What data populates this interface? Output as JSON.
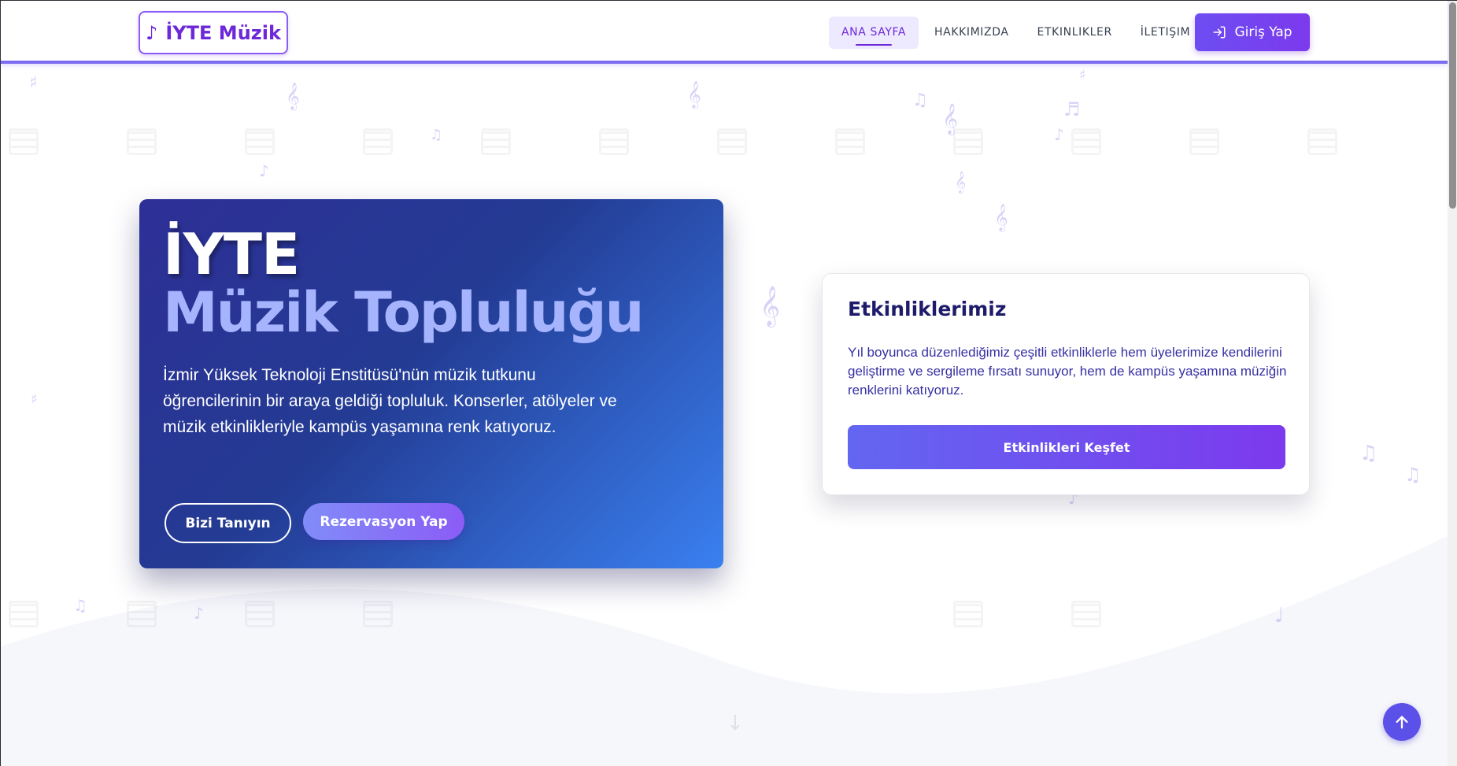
{
  "brand": {
    "note_icon": "music-note-icon",
    "note_glyph": "♪",
    "name": "İYTE Müzik"
  },
  "nav": {
    "items": [
      {
        "label": "ANA SAYFA",
        "active": true
      },
      {
        "label": "HAKKIMIZDA",
        "active": false
      },
      {
        "label": "ETKINLIKLER",
        "active": false
      },
      {
        "label": "İLETIŞIM",
        "active": false
      }
    ],
    "login_label": "Giriş Yap",
    "login_icon": "login-icon"
  },
  "hero": {
    "title_line1": "İYTE",
    "title_line2": "Müzik Topluluğu",
    "description": "İzmir Yüksek Teknoloji Enstitüsü'nün müzik tutkunu öğrencilerinin bir araya geldiği topluluk. Konserler, atölyeler ve müzik etkinlikleriyle kampüs yaşamına renk katıyoruz.",
    "primary_outline_button": "Bizi Tanıyın",
    "primary_fill_button": "Rezervasyon Yap"
  },
  "events": {
    "title": "Etkinliklerimiz",
    "description": "Yıl boyunca düzenlediğimiz çeşitli etkinliklerle hem üyelerimize kendilerini geliştirme ve sergileme fırsatı sunuyor, hem de kampüs yaşamına müziğin renklerini katıyoruz.",
    "button_label": "Etkinlikleri Keşfet"
  },
  "misc": {
    "scroll_down_icon": "arrow-down-icon",
    "scroll_down_glyph": "↓",
    "back_to_top_icon": "arrow-up-icon",
    "back_to_top_glyph": "↑"
  },
  "colors": {
    "accent": "#6d28d9",
    "hero_start": "#2e2f96",
    "hero_end": "#3a80f0",
    "button_gradient_start": "#6366f1",
    "button_gradient_end": "#7c3aed"
  }
}
